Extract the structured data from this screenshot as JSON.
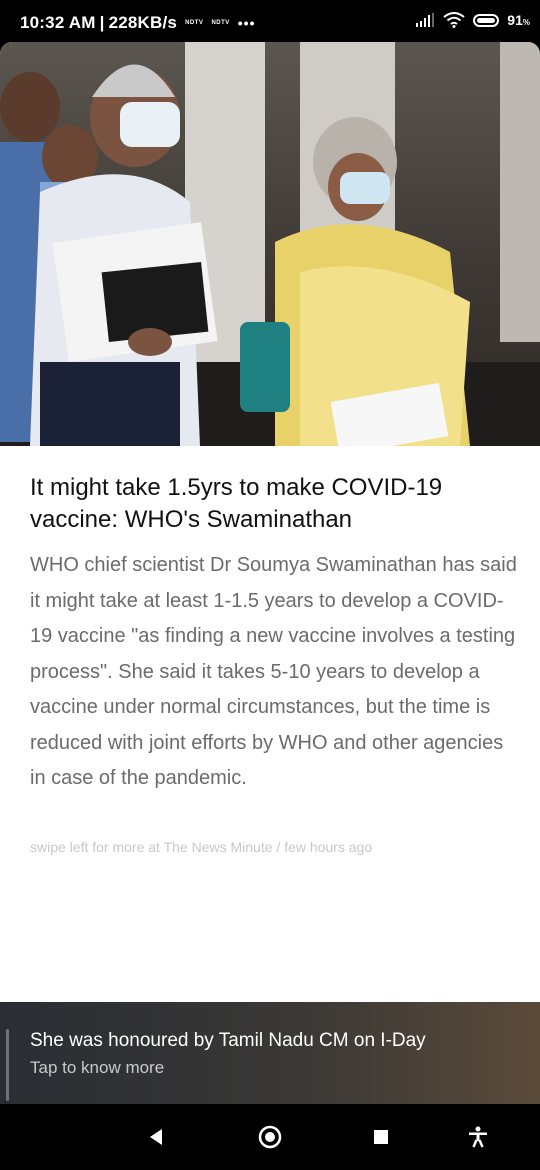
{
  "status_bar": {
    "time": "10:32 AM",
    "speed": "228KB/s",
    "app_tag_1": "NDTV",
    "app_tag_2": "NDTV",
    "more": "•••",
    "battery": "91",
    "battery_unit": "%",
    "battery_level": 0.91
  },
  "article": {
    "headline": "It might take 1.5yrs to make COVID-19 vaccine: WHO's Swaminathan",
    "summary": "WHO chief scientist Dr Soumya Swaminathan has said it might take at least 1-1.5 years to develop a COVID-19 vaccine \"as finding a new vaccine involves a testing process\". She said it takes 5-10 years to develop a vaccine under normal circumstances, but the time is reduced with joint efforts by WHO and other agencies in case of the pandemic.",
    "source_prefix": "swipe left for more at ",
    "source_name": "The News Minute",
    "source_sep": " / ",
    "time_ago": "few hours ago"
  },
  "teaser": {
    "title": "She was honoured by Tamil Nadu CM on I-Day",
    "subtitle": "Tap to know more"
  },
  "nav": {
    "icons": [
      "back-icon",
      "home-icon",
      "recents-icon",
      "accessibility-icon"
    ]
  }
}
